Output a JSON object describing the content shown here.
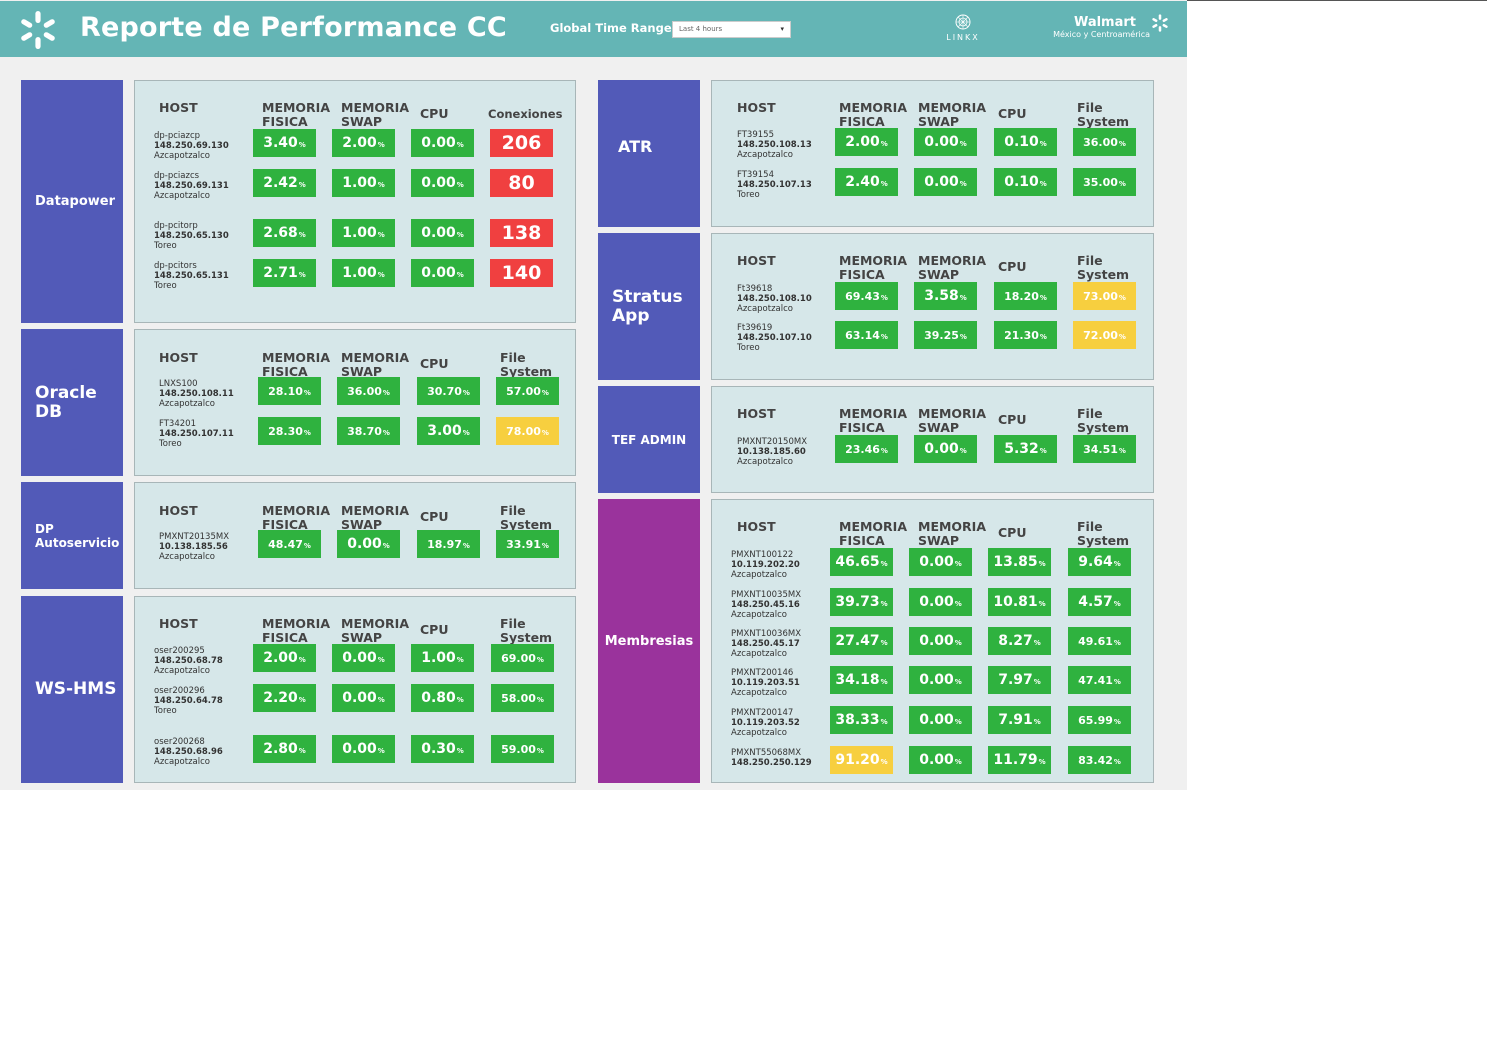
{
  "header": {
    "title": "Reporte de Performance CC",
    "time_range_label": "Global Time Range",
    "time_range_value": "Last 4 hours",
    "partner_logo": "LINKX",
    "brand_name": "Walmart",
    "brand_region": "México y Centroamérica",
    "colors": {
      "header_bg": "#64b5b5",
      "green": "#2fb23f",
      "yellow": "#f7cf3f",
      "red": "#f04040",
      "panel_bg": "#d6e7e9",
      "cat_blue": "#525ab8",
      "cat_purple": "#9a339c"
    }
  },
  "sections": {
    "datapower": {
      "name": "Datapower",
      "headers": [
        "HOST",
        "MEMORIA\nFISICA",
        "MEMORIA\nSWAP",
        "CPU",
        "Conexiones"
      ],
      "rows": [
        {
          "host": "dp-pciazcp",
          "ip": "148.250.69.130",
          "site": "Azcapotzalco",
          "values": [
            "3.40",
            "2.00",
            "0.00"
          ],
          "conexiones": "206",
          "status": [
            "green",
            "green",
            "green",
            "red"
          ]
        },
        {
          "host": "dp-pciazcs",
          "ip": "148.250.69.131",
          "site": "Azcapotzalco",
          "values": [
            "2.42",
            "1.00",
            "0.00"
          ],
          "conexiones": "80",
          "status": [
            "green",
            "green",
            "green",
            "red"
          ]
        },
        {
          "host": "dp-pcitorp",
          "ip": "148.250.65.130",
          "site": "Toreo",
          "values": [
            "2.68",
            "1.00",
            "0.00"
          ],
          "conexiones": "138",
          "status": [
            "green",
            "green",
            "green",
            "red"
          ]
        },
        {
          "host": "dp-pcitors",
          "ip": "148.250.65.131",
          "site": "Toreo",
          "values": [
            "2.71",
            "1.00",
            "0.00"
          ],
          "conexiones": "140",
          "status": [
            "green",
            "green",
            "green",
            "red"
          ]
        }
      ]
    },
    "oracle": {
      "name": "Oracle\nDB",
      "headers": [
        "HOST",
        "MEMORIA\nFISICA",
        "MEMORIA\nSWAP",
        "CPU",
        "File\nSystem"
      ],
      "rows": [
        {
          "host": "LNXS100",
          "ip": "148.250.108.11",
          "site": "Azcapotzalco",
          "values": [
            "28.10",
            "36.00",
            "30.70",
            "57.00"
          ],
          "status": [
            "green",
            "green",
            "green",
            "green"
          ]
        },
        {
          "host": "FT34201",
          "ip": "148.250.107.11",
          "site": "Toreo",
          "values": [
            "28.30",
            "38.70",
            "3.00",
            "78.00"
          ],
          "status": [
            "green",
            "green",
            "green",
            "yellow"
          ]
        }
      ]
    },
    "dp_autoservicio": {
      "name": "DP\nAutoservicio",
      "headers": [
        "HOST",
        "MEMORIA\nFISICA",
        "MEMORIA\nSWAP",
        "CPU",
        "File\nSystem"
      ],
      "rows": [
        {
          "host": "PMXNT20135MX",
          "ip": "10.138.185.56",
          "site": "Azcapotzalco",
          "values": [
            "48.47",
            "0.00",
            "18.97",
            "33.91"
          ],
          "status": [
            "green",
            "green",
            "green",
            "green"
          ]
        }
      ]
    },
    "ws_hms": {
      "name": "WS-HMS",
      "headers": [
        "HOST",
        "MEMORIA\nFISICA",
        "MEMORIA\nSWAP",
        "CPU",
        "File\nSystem"
      ],
      "rows": [
        {
          "host": "oser200295",
          "ip": "148.250.68.78",
          "site": "Azcapotzalco",
          "values": [
            "2.00",
            "0.00",
            "1.00",
            "69.00"
          ],
          "status": [
            "green",
            "green",
            "green",
            "green"
          ]
        },
        {
          "host": "oser200296",
          "ip": "148.250.64.78",
          "site": "Toreo",
          "values": [
            "2.20",
            "0.00",
            "0.80",
            "58.00"
          ],
          "status": [
            "green",
            "green",
            "green",
            "green"
          ]
        },
        {
          "host": "oser200268",
          "ip": "148.250.68.96",
          "site": "Azcapotzalco",
          "values": [
            "2.80",
            "0.00",
            "0.30",
            "59.00"
          ],
          "status": [
            "green",
            "green",
            "green",
            "green"
          ]
        }
      ]
    },
    "atr": {
      "name": "ATR",
      "headers": [
        "HOST",
        "MEMORIA\nFISICA",
        "MEMORIA\nSWAP",
        "CPU",
        "File\nSystem"
      ],
      "rows": [
        {
          "host": "FT39155",
          "ip": "148.250.108.13",
          "site": "Azcapotzalco",
          "values": [
            "2.00",
            "0.00",
            "0.10",
            "36.00"
          ],
          "status": [
            "green",
            "green",
            "green",
            "green"
          ]
        },
        {
          "host": "FT39154",
          "ip": "148.250.107.13",
          "site": "Toreo",
          "values": [
            "2.40",
            "0.00",
            "0.10",
            "35.00"
          ],
          "status": [
            "green",
            "green",
            "green",
            "green"
          ]
        }
      ]
    },
    "stratus": {
      "name": "Stratus\nApp",
      "headers": [
        "HOST",
        "MEMORIA\nFISICA",
        "MEMORIA\nSWAP",
        "CPU",
        "File\nSystem"
      ],
      "rows": [
        {
          "host": "Ft39618",
          "ip": "148.250.108.10",
          "site": "Azcapotzalco",
          "values": [
            "69.43",
            "3.58",
            "18.20",
            "73.00"
          ],
          "status": [
            "green",
            "green",
            "green",
            "yellow"
          ]
        },
        {
          "host": "Ft39619",
          "ip": "148.250.107.10",
          "site": "Toreo",
          "values": [
            "63.14",
            "39.25",
            "21.30",
            "72.00"
          ],
          "status": [
            "green",
            "green",
            "green",
            "yellow"
          ]
        }
      ]
    },
    "tef_admin": {
      "name": "TEF ADMIN",
      "headers": [
        "HOST",
        "MEMORIA\nFISICA",
        "MEMORIA\nSWAP",
        "CPU",
        "File\nSystem"
      ],
      "rows": [
        {
          "host": "PMXNT20150MX",
          "ip": "10.138.185.60",
          "site": "Azcapotzalco",
          "values": [
            "23.46",
            "0.00",
            "5.32",
            "34.51"
          ],
          "status": [
            "green",
            "green",
            "green",
            "green"
          ]
        }
      ]
    },
    "membresias": {
      "name": "Membresias",
      "headers": [
        "HOST",
        "MEMORIA\nFISICA",
        "MEMORIA\nSWAP",
        "CPU",
        "File\nSystem"
      ],
      "rows": [
        {
          "host": "PMXNT100122",
          "ip": "10.119.202.20",
          "site": "Azcapotzalco",
          "values": [
            "46.65",
            "0.00",
            "13.85",
            "9.64"
          ],
          "status": [
            "green",
            "green",
            "green",
            "green"
          ]
        },
        {
          "host": "PMXNT10035MX",
          "ip": "148.250.45.16",
          "site": "Azcapotzalco",
          "values": [
            "39.73",
            "0.00",
            "10.81",
            "4.57"
          ],
          "status": [
            "green",
            "green",
            "green",
            "green"
          ]
        },
        {
          "host": "PMXNT10036MX",
          "ip": "148.250.45.17",
          "site": "Azcapotzalco",
          "values": [
            "27.47",
            "0.00",
            "8.27",
            "49.61"
          ],
          "status": [
            "green",
            "green",
            "green",
            "green"
          ]
        },
        {
          "host": "PMXNT200146",
          "ip": "10.119.203.51",
          "site": "Azcapotzalco",
          "values": [
            "34.18",
            "0.00",
            "7.97",
            "47.41"
          ],
          "status": [
            "green",
            "green",
            "green",
            "green"
          ]
        },
        {
          "host": "PMXNT200147",
          "ip": "10.119.203.52",
          "site": "Azcapotzalco",
          "values": [
            "38.33",
            "0.00",
            "7.91",
            "65.99"
          ],
          "status": [
            "green",
            "green",
            "green",
            "green"
          ]
        },
        {
          "host": "PMXNT55068MX",
          "ip": "148.250.250.129",
          "site": "",
          "values": [
            "91.20",
            "0.00",
            "11.79",
            "83.42"
          ],
          "status": [
            "yellow",
            "green",
            "green",
            "green"
          ]
        }
      ]
    }
  }
}
